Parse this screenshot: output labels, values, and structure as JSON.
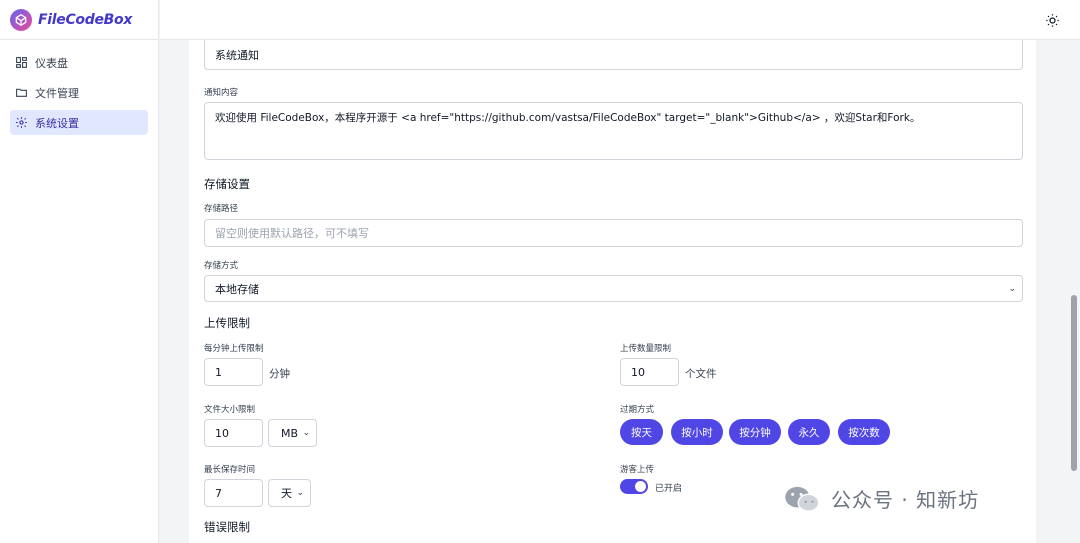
{
  "app": {
    "name": "FileCodeBox"
  },
  "sidebar": {
    "items": [
      {
        "label": "仪表盘",
        "icon": "dashboard-icon"
      },
      {
        "label": "文件管理",
        "icon": "folder-icon"
      },
      {
        "label": "系统设置",
        "icon": "gear-icon",
        "active": true
      }
    ]
  },
  "header": {
    "theme_icon": "sun-icon"
  },
  "form": {
    "notice_title_value": "系统通知",
    "notice_content_label": "通知内容",
    "notice_content_value": "欢迎使用 FileCodeBox，本程序开源于 <a href=\"https://github.com/vastsa/FileCodeBox\" target=\"_blank\">Github</a> ，欢迎Star和Fork。",
    "storage_section": "存储设置",
    "storage_path_label": "存储路径",
    "storage_path_placeholder": "留空则使用默认路径，可不填写",
    "storage_method_label": "存储方式",
    "storage_method_value": "本地存储",
    "upload_section": "上传限制",
    "per_minute_label": "每分钟上传限制",
    "per_minute_value": "1",
    "per_minute_unit": "分钟",
    "upload_count_label": "上传数量限制",
    "upload_count_value": "10",
    "upload_count_unit": "个文件",
    "file_size_label": "文件大小限制",
    "file_size_value": "10",
    "file_size_unit": "MB",
    "expire_label": "过期方式",
    "expire_options": [
      "按天",
      "按小时",
      "按分钟",
      "永久",
      "按次数"
    ],
    "max_save_label": "最长保存时间",
    "max_save_value": "7",
    "max_save_unit": "天",
    "guest_upload_label": "游客上传",
    "guest_upload_status": "已开启",
    "error_section": "错误限制"
  },
  "watermark": {
    "text": "公众号 · 知新坊"
  },
  "colors": {
    "accent": "#4f46e5",
    "active_bg": "#e0e7ff"
  }
}
